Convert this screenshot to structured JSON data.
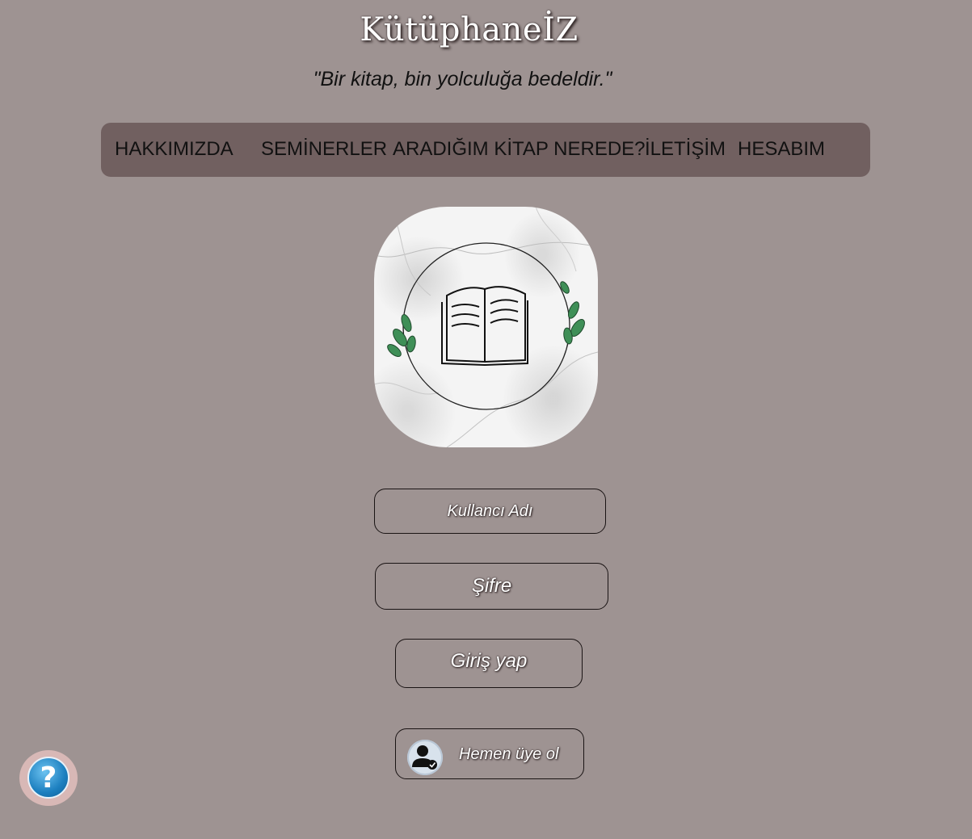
{
  "site_title": "KütüphaneİZ",
  "tagline": "\"Bir kitap, bin yolculuğa bedeldir.\"",
  "nav": {
    "items": [
      {
        "label": "HAKKIMIZDA"
      },
      {
        "label": "SEMİNERLER"
      },
      {
        "label": "ARADIĞIM KİTAP NEREDE?"
      },
      {
        "label": "İLETİŞİM"
      },
      {
        "label": "HESABIM"
      }
    ]
  },
  "login_form": {
    "username_placeholder": "Kullancı Adı",
    "password_placeholder": "Şifre",
    "login_button": "Giriş yap",
    "register_button": "Hemen üye ol"
  },
  "help": {
    "symbol": "?"
  },
  "colors": {
    "background": "#9e9392",
    "nav_background": "#716060",
    "help_accent": "#1c7fbf"
  }
}
